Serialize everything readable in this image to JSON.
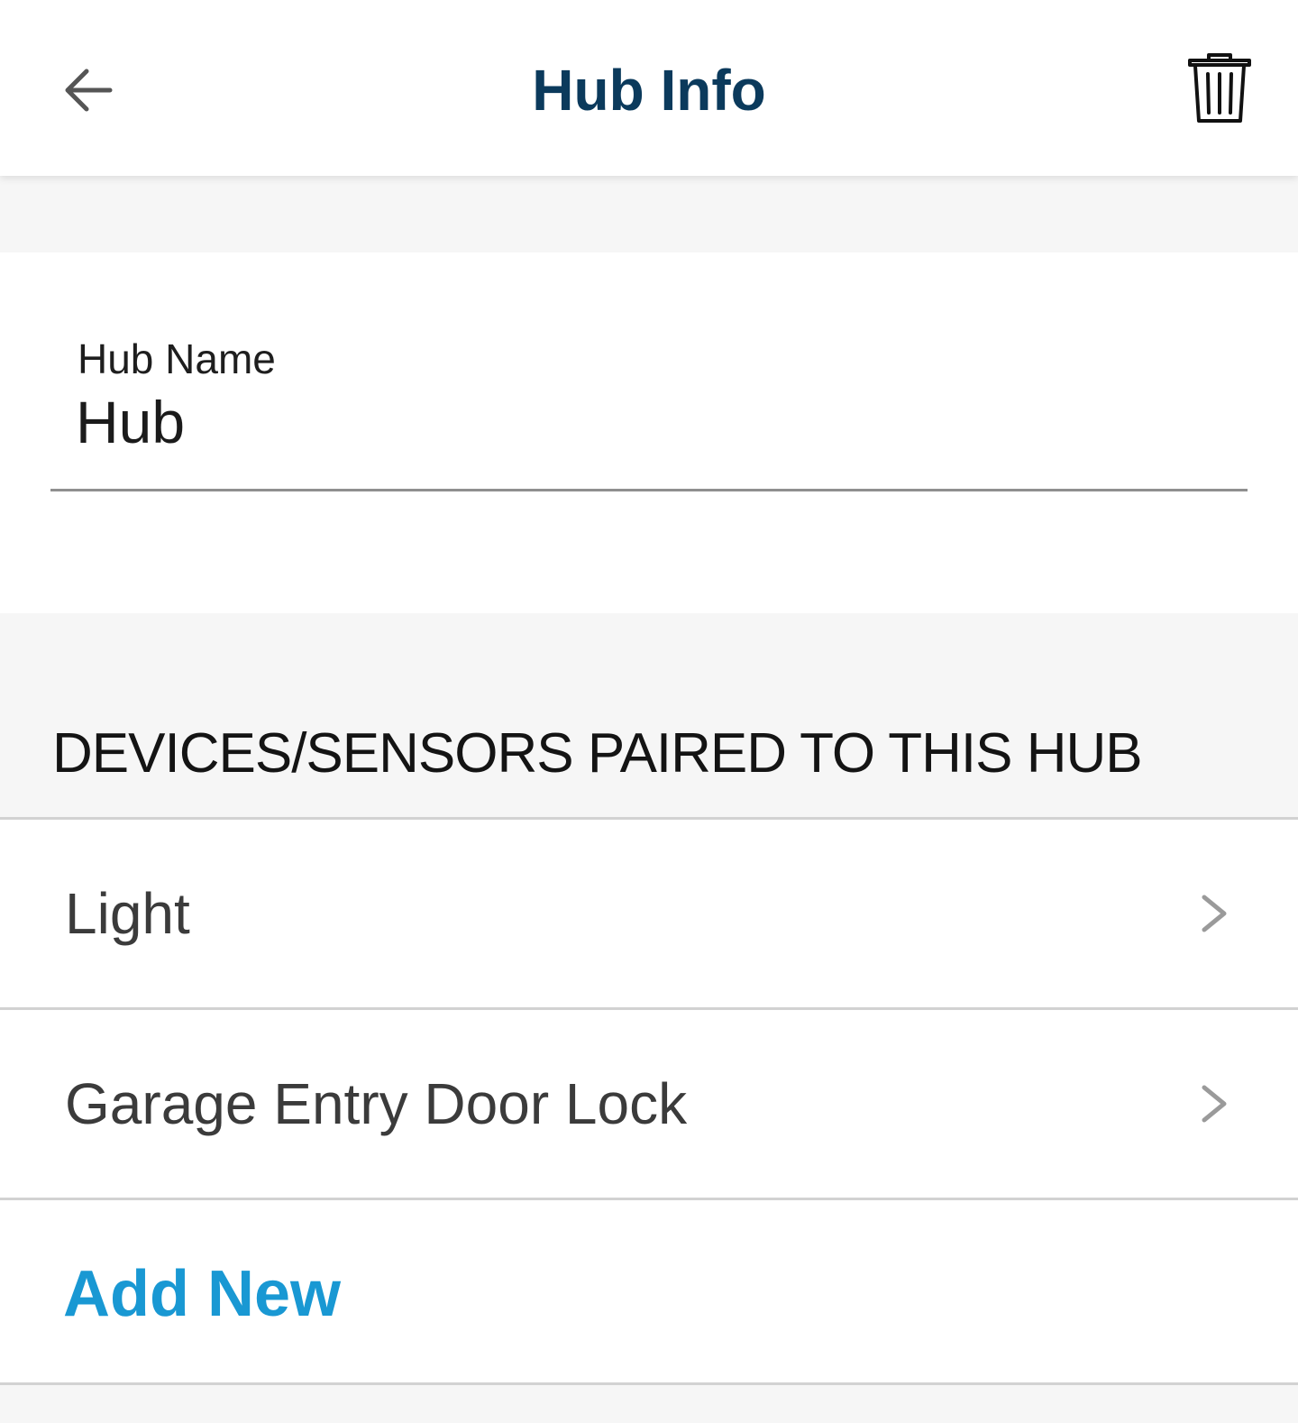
{
  "header": {
    "title": "Hub Info",
    "back_icon": "arrow-left-icon",
    "delete_icon": "trash-icon"
  },
  "hub_name_field": {
    "label": "Hub Name",
    "value": "Hub"
  },
  "devices_section": {
    "heading": "DEVICES/SENSORS PAIRED TO THIS HUB",
    "items": [
      {
        "label": "Light",
        "icon": "chevron-right-icon"
      },
      {
        "label": "Garage Entry Door Lock",
        "icon": "chevron-right-icon"
      }
    ],
    "add_new_label": "Add New"
  },
  "colors": {
    "title": "#0b3a5c",
    "accent": "#1998d3",
    "background": "#f6f6f6"
  }
}
